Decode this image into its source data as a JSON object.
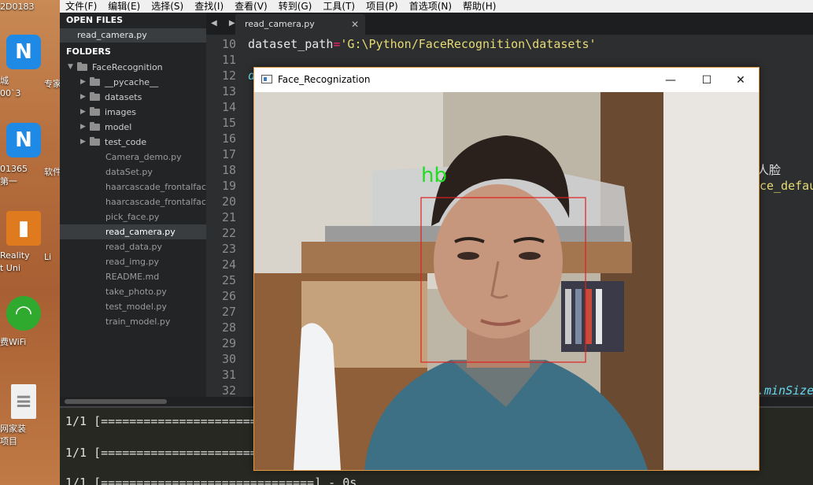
{
  "desktop": {
    "icons": [
      {
        "label1": "2D0183",
        "label2": ""
      },
      {
        "label1": "城",
        "label2": "00`3"
      },
      {
        "label1": "01365",
        "label2": "第一"
      },
      {
        "label1": "Reality",
        "label2": "t Uni"
      },
      {
        "label1": "费WiFi",
        "label2": ""
      },
      {
        "label1": "网家装",
        "label2": "项目"
      }
    ],
    "col2": [
      "专家",
      "软件",
      "Li"
    ]
  },
  "menubar": {
    "items": [
      "文件(F)",
      "编辑(E)",
      "选择(S)",
      "查找(I)",
      "查看(V)",
      "转到(G)",
      "工具(T)",
      "项目(P)",
      "首选项(N)",
      "帮助(H)"
    ]
  },
  "sidebar": {
    "open_files_heading": "OPEN FILES",
    "open_file": "read_camera.py",
    "folders_heading": "FOLDERS",
    "root": "FaceRecognition",
    "dirs": [
      "__pycache__",
      "datasets",
      "images",
      "model",
      "test_code"
    ],
    "files": [
      "Camera_demo.py",
      "dataSet.py",
      "haarcascade_frontalface_",
      "haarcascade_frontalface_",
      "pick_face.py",
      "read_camera.py",
      "read_data.py",
      "read_img.py",
      "README.md",
      "take_photo.py",
      "test_model.py",
      "train_model.py"
    ],
    "selected_file": "read_camera.py"
  },
  "tabbar": {
    "nav": "◀ ▶",
    "active_tab": "read_camera.py",
    "close": "✕"
  },
  "editor": {
    "line_numbers": [
      "10",
      "11",
      "12",
      "13",
      "14",
      "15",
      "16",
      "17",
      "18",
      "19",
      "20",
      "21",
      "22",
      "23",
      "24",
      "25",
      "26",
      "27",
      "28",
      "29",
      "30",
      "31",
      "32"
    ],
    "line10_var": "dataset_path",
    "line10_op": "=",
    "line10_str": "'G:\\Python/FaceRecognition\\datasets'",
    "line12_kw": "d",
    "line18_tail": "人脸",
    "line19_tail": "ce_defau",
    "line32_tail": ".minSize"
  },
  "console": {
    "lines": [
      "1/1 [===========================",
      "1/1 [===========================",
      "1/1 [==============================] - 0s"
    ]
  },
  "face_window": {
    "title": "Face_Recognization",
    "minimize": "—",
    "maximize": "☐",
    "close": "✕",
    "detection_label": "hb",
    "box_color": "#e02020",
    "label_color": "#22dd22"
  }
}
